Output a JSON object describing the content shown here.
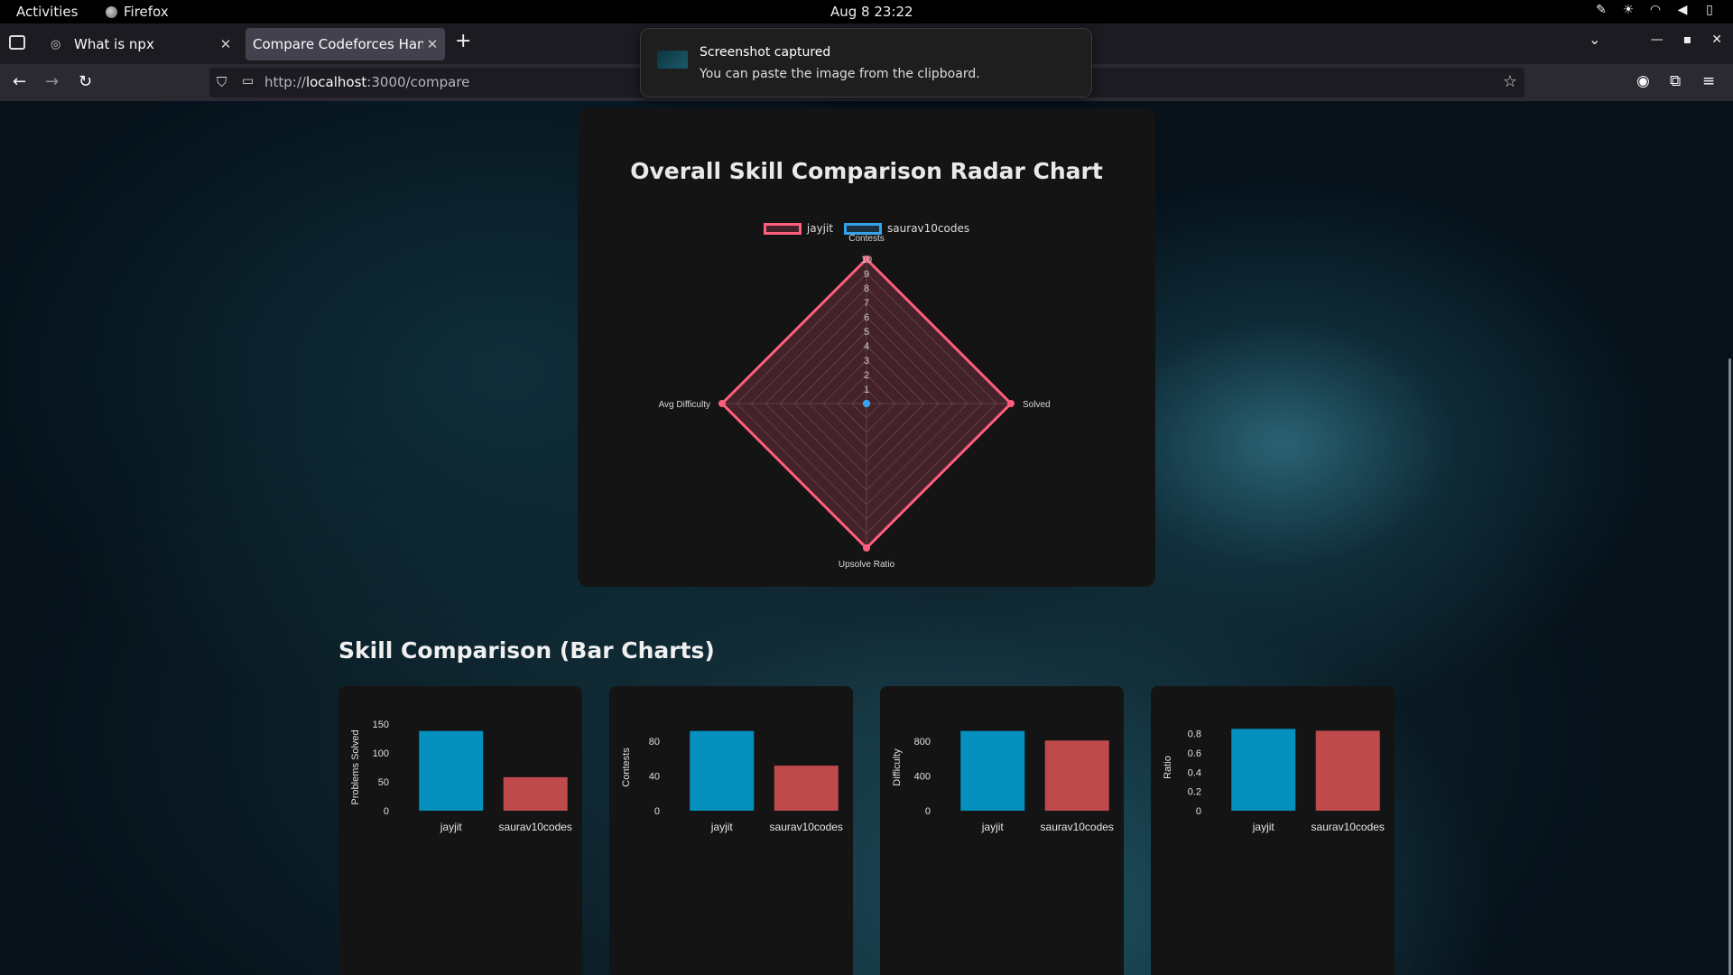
{
  "system": {
    "activities": "Activities",
    "app_name": "Firefox",
    "clock": "Aug 8  23:22"
  },
  "tabs": [
    {
      "title": "What is npx"
    },
    {
      "title": "Compare Codeforces Handle"
    }
  ],
  "address": {
    "prefix": "http://",
    "host": "localhost",
    "path": ":3000/compare"
  },
  "notification": {
    "title": "Screenshot captured",
    "body": "You can paste the image from the clipboard."
  },
  "radar": {
    "title": "Overall Skill Comparison Radar Chart",
    "legend": [
      {
        "label": "jayjit",
        "color": "#ff5f7e"
      },
      {
        "label": "saurav10codes",
        "color": "#36a2eb"
      }
    ]
  },
  "bar_section_title": "Skill Comparison (Bar Charts)",
  "chart_data": [
    {
      "type": "radar",
      "title": "Overall Skill Comparison Radar Chart",
      "axes": [
        "Contests",
        "Solved",
        "Upsolve Ratio",
        "Avg Difficulty"
      ],
      "range": [
        0,
        10
      ],
      "ticks": [
        1,
        2,
        3,
        4,
        5,
        6,
        7,
        8,
        9,
        10
      ],
      "series": [
        {
          "name": "jayjit",
          "color": "#ff5f7e",
          "values": [
            10,
            10,
            10,
            10
          ]
        },
        {
          "name": "saurav10codes",
          "color": "#36a2eb",
          "values": [
            0,
            0,
            0,
            0
          ]
        }
      ],
      "legend": "top"
    },
    {
      "type": "bar",
      "categories": [
        "jayjit",
        "saurav10codes"
      ],
      "values": [
        138,
        58
      ],
      "colors": [
        "#0590be",
        "#bf4a4c"
      ],
      "ylabel": "Problems Solved",
      "ylim": [
        0,
        150
      ],
      "ticks": [
        0,
        50,
        100,
        150
      ]
    },
    {
      "type": "bar",
      "categories": [
        "jayjit",
        "saurav10codes"
      ],
      "values": [
        92,
        52
      ],
      "colors": [
        "#0590be",
        "#bf4a4c"
      ],
      "ylabel": "Contests",
      "ylim": [
        0,
        100
      ],
      "ticks": [
        0,
        40,
        80
      ]
    },
    {
      "type": "bar",
      "categories": [
        "jayjit",
        "saurav10codes"
      ],
      "values": [
        920,
        810
      ],
      "colors": [
        "#0590be",
        "#bf4a4c"
      ],
      "ylabel": "Difficulty",
      "ylim": [
        0,
        1000
      ],
      "ticks": [
        0,
        400,
        800
      ]
    },
    {
      "type": "bar",
      "categories": [
        "jayjit",
        "saurav10codes"
      ],
      "values": [
        0.85,
        0.83
      ],
      "colors": [
        "#0590be",
        "#bf4a4c"
      ],
      "ylabel": "Ratio",
      "ylim": [
        0,
        0.9
      ],
      "ticks": [
        0,
        0.2,
        0.4,
        0.6,
        0.8
      ]
    }
  ]
}
